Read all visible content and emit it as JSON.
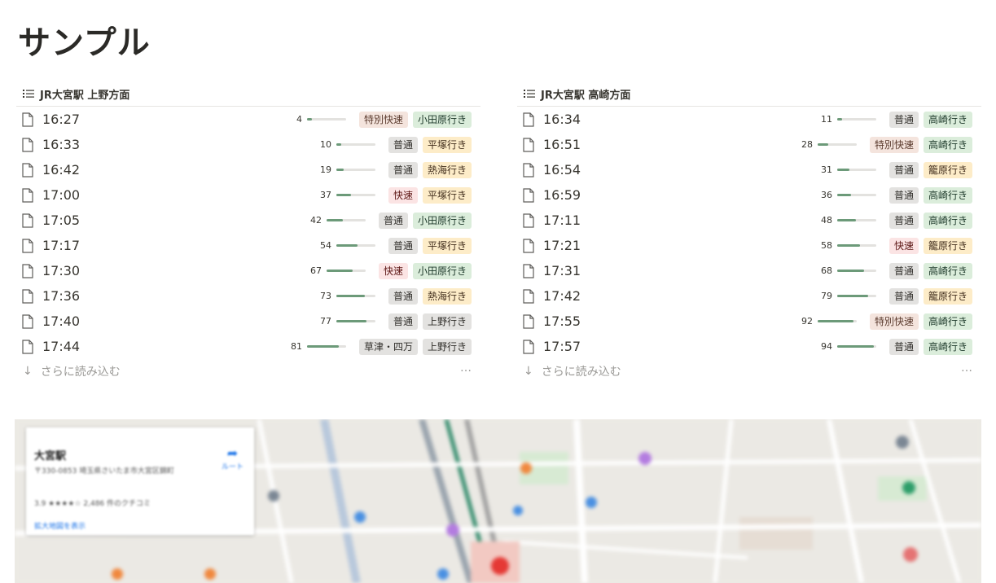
{
  "page": {
    "title": "サンプル"
  },
  "panels": [
    {
      "title": "JR大宮駅 上野方面",
      "rows": [
        {
          "time": "16:27",
          "num": "4",
          "fill": 0.04,
          "type": "特別快速",
          "dest": "小田原行き"
        },
        {
          "time": "16:33",
          "num": "10",
          "fill": 0.1,
          "type": "普通",
          "dest": "平塚行き"
        },
        {
          "time": "16:42",
          "num": "19",
          "fill": 0.19,
          "type": "普通",
          "dest": "熱海行き"
        },
        {
          "time": "17:00",
          "num": "37",
          "fill": 0.37,
          "type": "快速",
          "dest": "平塚行き"
        },
        {
          "time": "17:05",
          "num": "42",
          "fill": 0.42,
          "type": "普通",
          "dest": "小田原行き"
        },
        {
          "time": "17:17",
          "num": "54",
          "fill": 0.54,
          "type": "普通",
          "dest": "平塚行き"
        },
        {
          "time": "17:30",
          "num": "67",
          "fill": 0.67,
          "type": "快速",
          "dest": "小田原行き"
        },
        {
          "time": "17:36",
          "num": "73",
          "fill": 0.73,
          "type": "普通",
          "dest": "熱海行き"
        },
        {
          "time": "17:40",
          "num": "77",
          "fill": 0.77,
          "type": "普通",
          "dest": "上野行き"
        },
        {
          "time": "17:44",
          "num": "81",
          "fill": 0.81,
          "type": "草津・四万",
          "dest": "上野行き"
        }
      ],
      "load_more": "さらに読み込む",
      "more_icon": "…"
    },
    {
      "title": "JR大宮駅 高崎方面",
      "rows": [
        {
          "time": "16:34",
          "num": "11",
          "fill": 0.11,
          "type": "普通",
          "dest": "高崎行き"
        },
        {
          "time": "16:51",
          "num": "28",
          "fill": 0.28,
          "type": "特別快速",
          "dest": "高崎行き"
        },
        {
          "time": "16:54",
          "num": "31",
          "fill": 0.31,
          "type": "普通",
          "dest": "籠原行き"
        },
        {
          "time": "16:59",
          "num": "36",
          "fill": 0.36,
          "type": "普通",
          "dest": "高崎行き"
        },
        {
          "time": "17:11",
          "num": "48",
          "fill": 0.48,
          "type": "普通",
          "dest": "高崎行き"
        },
        {
          "time": "17:21",
          "num": "58",
          "fill": 0.58,
          "type": "快速",
          "dest": "籠原行き"
        },
        {
          "time": "17:31",
          "num": "68",
          "fill": 0.68,
          "type": "普通",
          "dest": "高崎行き"
        },
        {
          "time": "17:42",
          "num": "79",
          "fill": 0.79,
          "type": "普通",
          "dest": "籠原行き"
        },
        {
          "time": "17:55",
          "num": "92",
          "fill": 0.92,
          "type": "特別快速",
          "dest": "高崎行き"
        },
        {
          "time": "17:57",
          "num": "94",
          "fill": 0.94,
          "type": "普通",
          "dest": "高崎行き"
        }
      ],
      "load_more": "さらに読み込む",
      "more_icon": "…"
    }
  ],
  "tag_colors": {
    "普通": {
      "bg": "#e3e2e0",
      "fg": "#32302c"
    },
    "快速": {
      "bg": "#fbe4e4",
      "fg": "#5d1715"
    },
    "特別快速": {
      "bg": "#f4e4dd",
      "fg": "#5a3a2d"
    },
    "草津・四万": {
      "bg": "#e3e2e0",
      "fg": "#32302c"
    },
    "小田原行き": {
      "bg": "#dbeddb",
      "fg": "#1c3829"
    },
    "高崎行き": {
      "bg": "#dbeddb",
      "fg": "#1c3829"
    },
    "平塚行き": {
      "bg": "#fdecc8",
      "fg": "#402c1b"
    },
    "熱海行き": {
      "bg": "#fdecc8",
      "fg": "#402c1b"
    },
    "籠原行き": {
      "bg": "#fdecc8",
      "fg": "#402c1b"
    },
    "上野行き": {
      "bg": "#e3e2e0",
      "fg": "#32302c"
    }
  },
  "map": {
    "place_name": "大宮駅",
    "address": "〒330-0853 埼玉県さいたま市大宮区錦町",
    "rating": "3.9 ★★★★☆ 2,486 件のクチコミ",
    "larger_map_link": "拡大地図を表示",
    "route_label": "ルート"
  }
}
